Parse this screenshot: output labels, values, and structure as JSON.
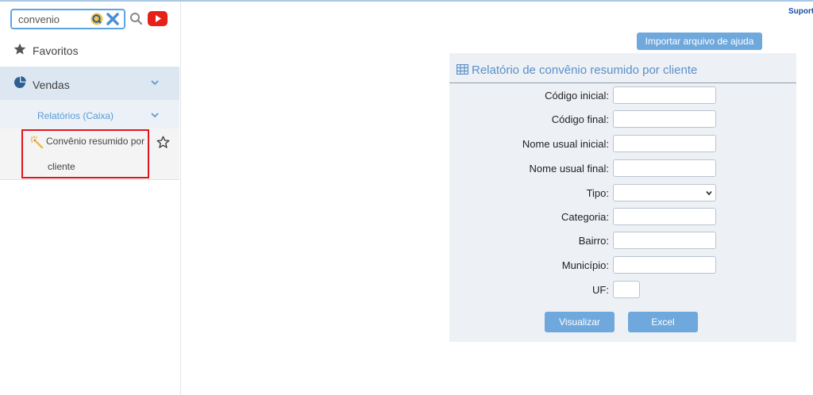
{
  "search": {
    "value": "convenio"
  },
  "sidebar": {
    "favorites_label": "Favoritos",
    "vendas_label": "Vendas",
    "relatorios_label": "Relatórios (Caixa)",
    "item": {
      "line1": "Convênio resumido por",
      "line2": "cliente"
    }
  },
  "header": {
    "support_label": "Suport"
  },
  "help_button": "Importar arquivo de ajuda",
  "panel": {
    "title": "Relatório de convênio resumido por cliente",
    "fields": {
      "codigo_inicial": "Código inicial:",
      "codigo_final": "Código final:",
      "nome_usual_inicial": "Nome usual inicial:",
      "nome_usual_final": "Nome usual final:",
      "tipo": "Tipo:",
      "categoria": "Categoria:",
      "bairro": "Bairro:",
      "municipio": "Município:",
      "uf": "UF:"
    },
    "buttons": {
      "visualizar": "Visualizar",
      "excel": "Excel"
    }
  },
  "colors": {
    "accent": "#6fa8dc",
    "highlight_border": "#e0161e",
    "title_blue": "#5a8fc8",
    "youtube_red": "#e62117"
  },
  "icons": [
    "search-icon",
    "clear-icon",
    "youtube-icon",
    "star-icon",
    "pie-chart-icon",
    "chevron-down-icon",
    "magic-wand-icon",
    "star-outline-icon",
    "table-grid-icon"
  ]
}
